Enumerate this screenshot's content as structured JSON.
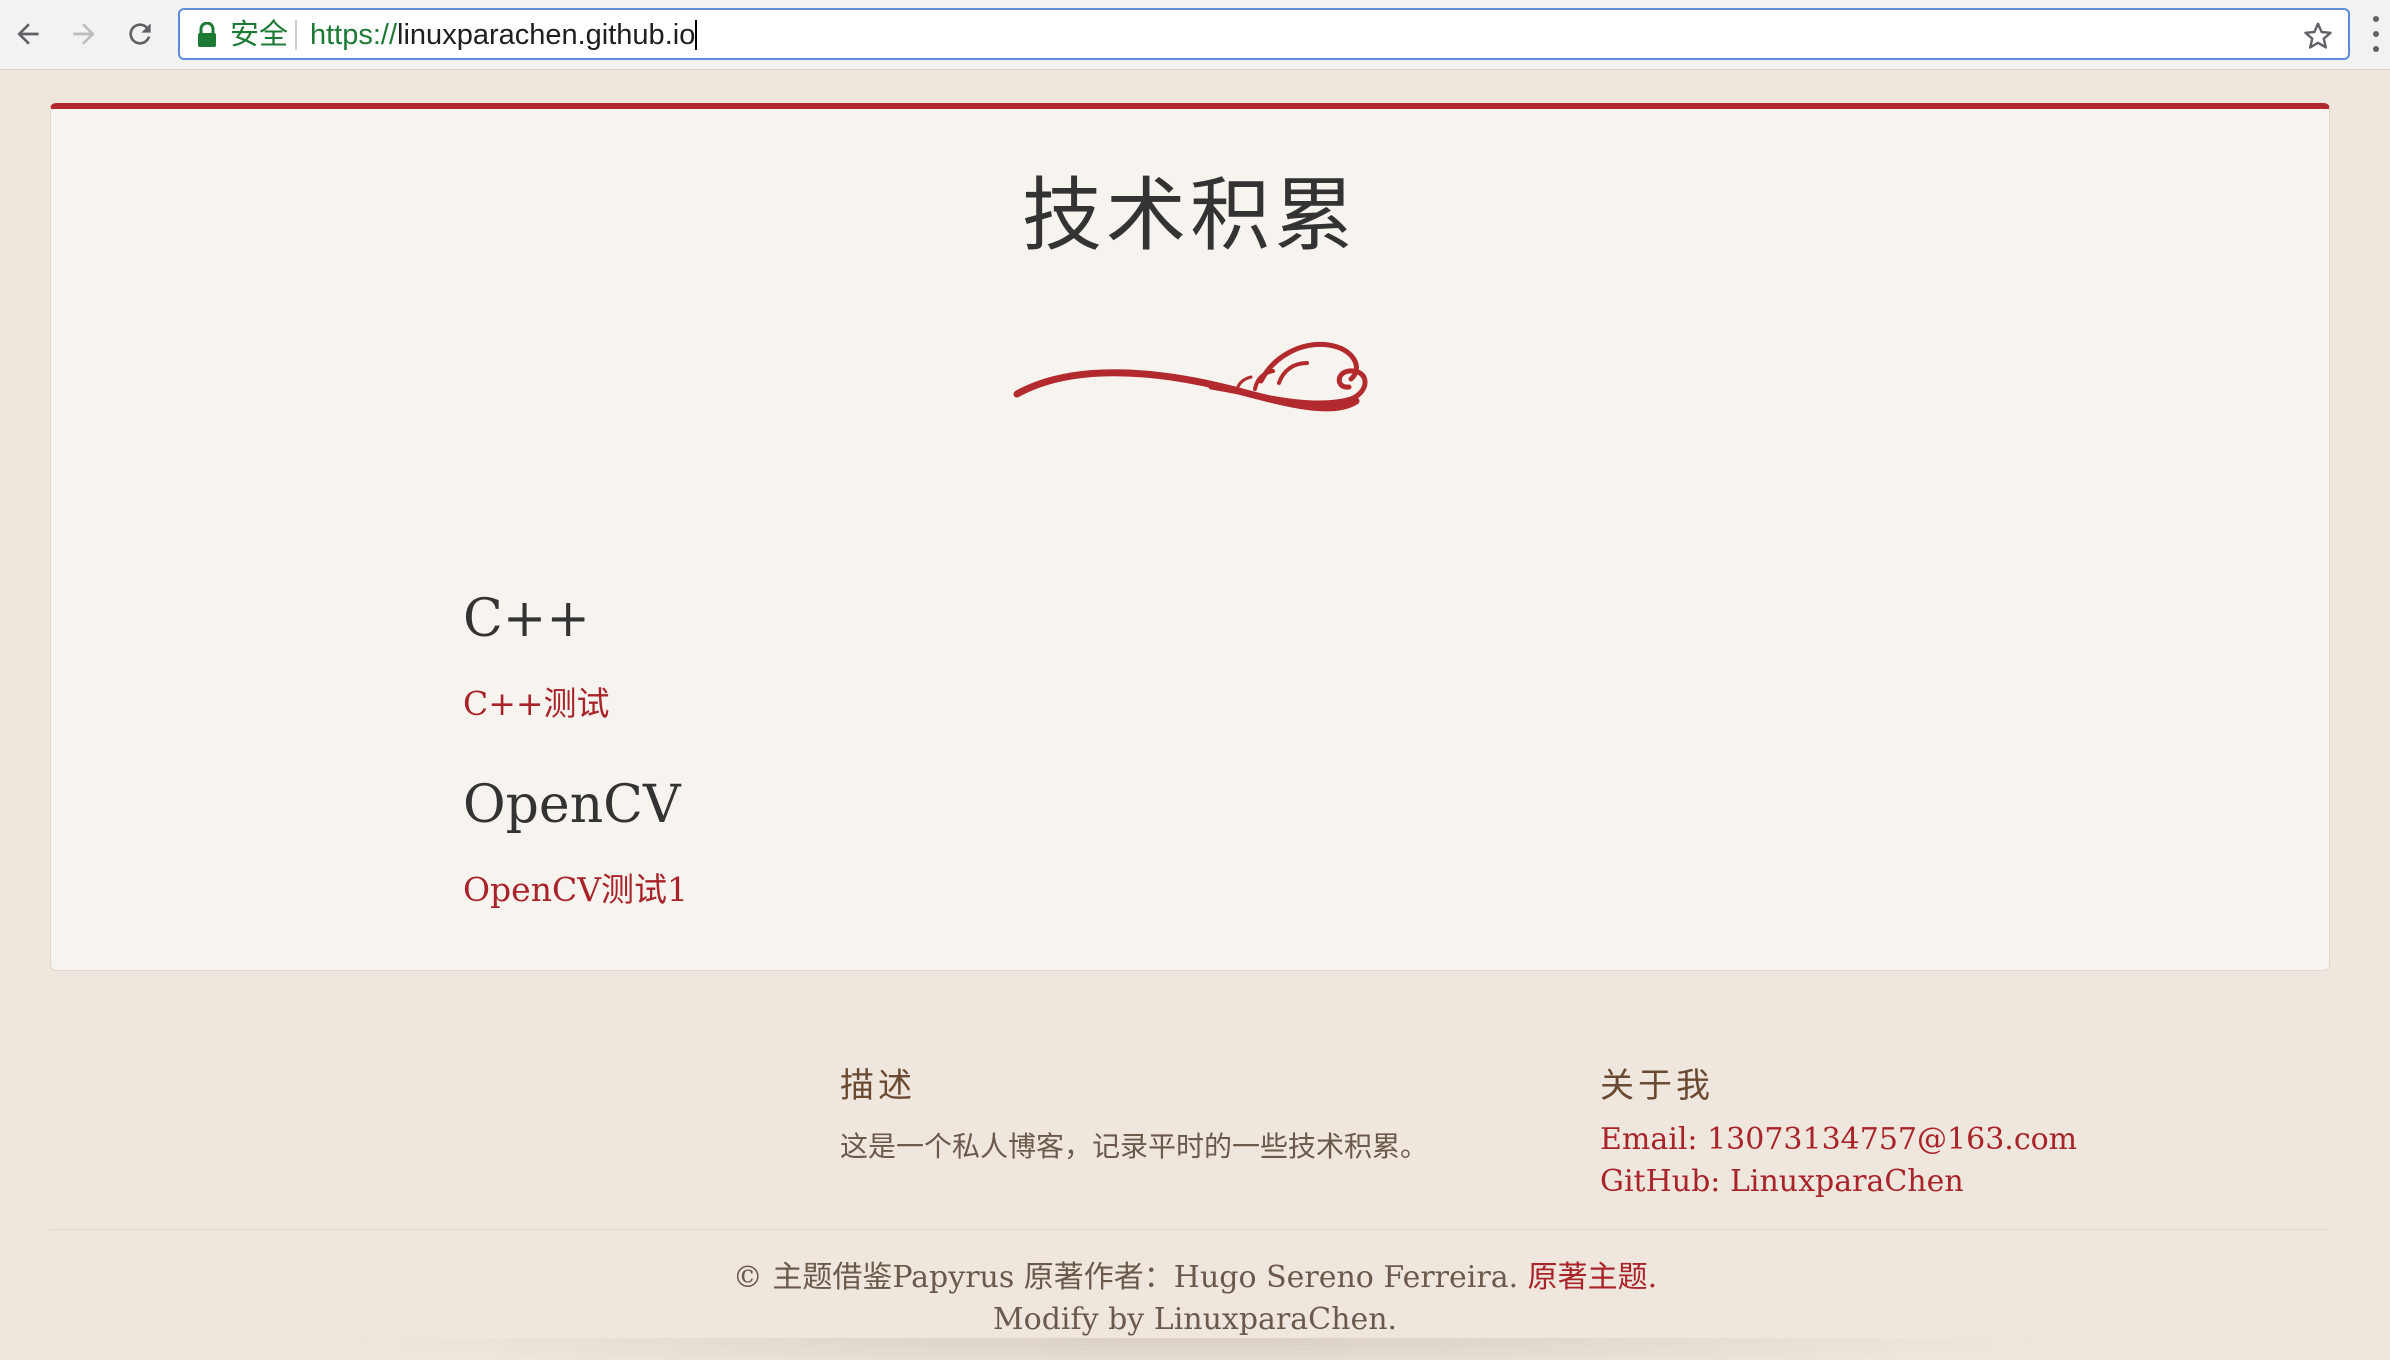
{
  "browser": {
    "secure_label": "安全",
    "url_scheme": "https://",
    "url_host": "linuxparachen.github.io",
    "icons": [
      "back-arrow-icon",
      "forward-arrow-icon",
      "reload-icon",
      "lock-icon",
      "star-icon",
      "menu-icon"
    ]
  },
  "site": {
    "title": "技术积累"
  },
  "sections": [
    {
      "heading": "C++",
      "posts": [
        "C++测试"
      ]
    },
    {
      "heading": "OpenCV",
      "posts": [
        "OpenCV测试1"
      ]
    }
  ],
  "footer": {
    "description": {
      "heading": "描述",
      "text": "这是一个私人博客，记录平时的一些技术积累。"
    },
    "about": {
      "heading": "关于我",
      "email": "Email: 13073134757@163.com",
      "github": "GitHub: LinuxparaChen"
    },
    "copyright": "© 主题借鉴Papyrus 原著作者：Hugo Sereno Ferreira.",
    "original_theme_link": "原著主题.",
    "modified_by": "Modify by LinuxparaChen."
  },
  "colors": {
    "accent": "#b22a2e",
    "link": "#a8232a",
    "page_background": "#efe7dd",
    "card_background": "#f7f3ef"
  }
}
